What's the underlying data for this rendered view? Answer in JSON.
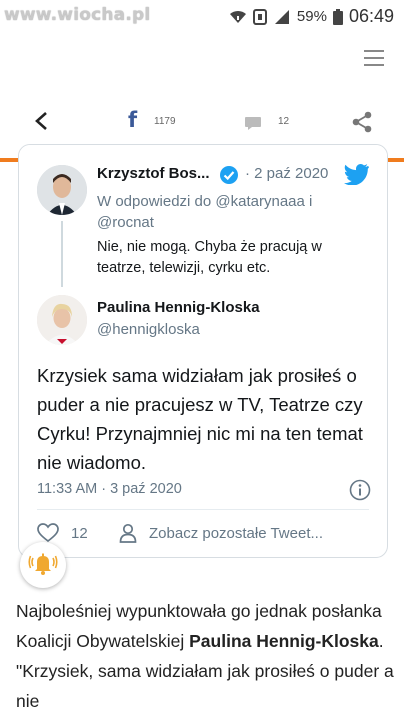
{
  "statusbar": {
    "watermark": "www.wiocha.pl",
    "battery": "59%",
    "time": "06:49"
  },
  "toolbar": {
    "fb_label": "f",
    "fb_count": "1179",
    "comment_count": "12"
  },
  "tweet1": {
    "name": "Krzysztof Bos...",
    "date": "· 2 paź 2020",
    "reply_line1": "W odpowiedzi do @katarynaaa i",
    "reply_line2": "@rocnat",
    "text": "Nie, nie mogą. Chyba że pracują w teatrze, telewizji, cyrku etc."
  },
  "tweet2": {
    "name": "Paulina Hennig-Kloska",
    "handle": "@hennigkloska",
    "text": "Krzysiek sama widziałam jak prosiłeś o puder a nie pracujesz w TV, Teatrze czy Cyrku! Przynajmniej nic mi na ten temat nie wiadomo.",
    "time": "11:33 AM · 3 paź 2020",
    "likes": "12",
    "see_more": "Zobacz pozostałe Tweet..."
  },
  "article": {
    "part1": "Najboleśniej wypunktowała go jednak posłanka Koalicji Obywatelskiej ",
    "bold": "Paulina Hennig-Kloska",
    "part2": ". \"Krzysiek, sama widziałam jak prosiłeś o puder a nie"
  },
  "colors": {
    "accent_orange": "#f07c1e",
    "twitter_blue": "#1da1f2",
    "facebook_blue": "#3b5998",
    "muted_gray": "#657786"
  }
}
